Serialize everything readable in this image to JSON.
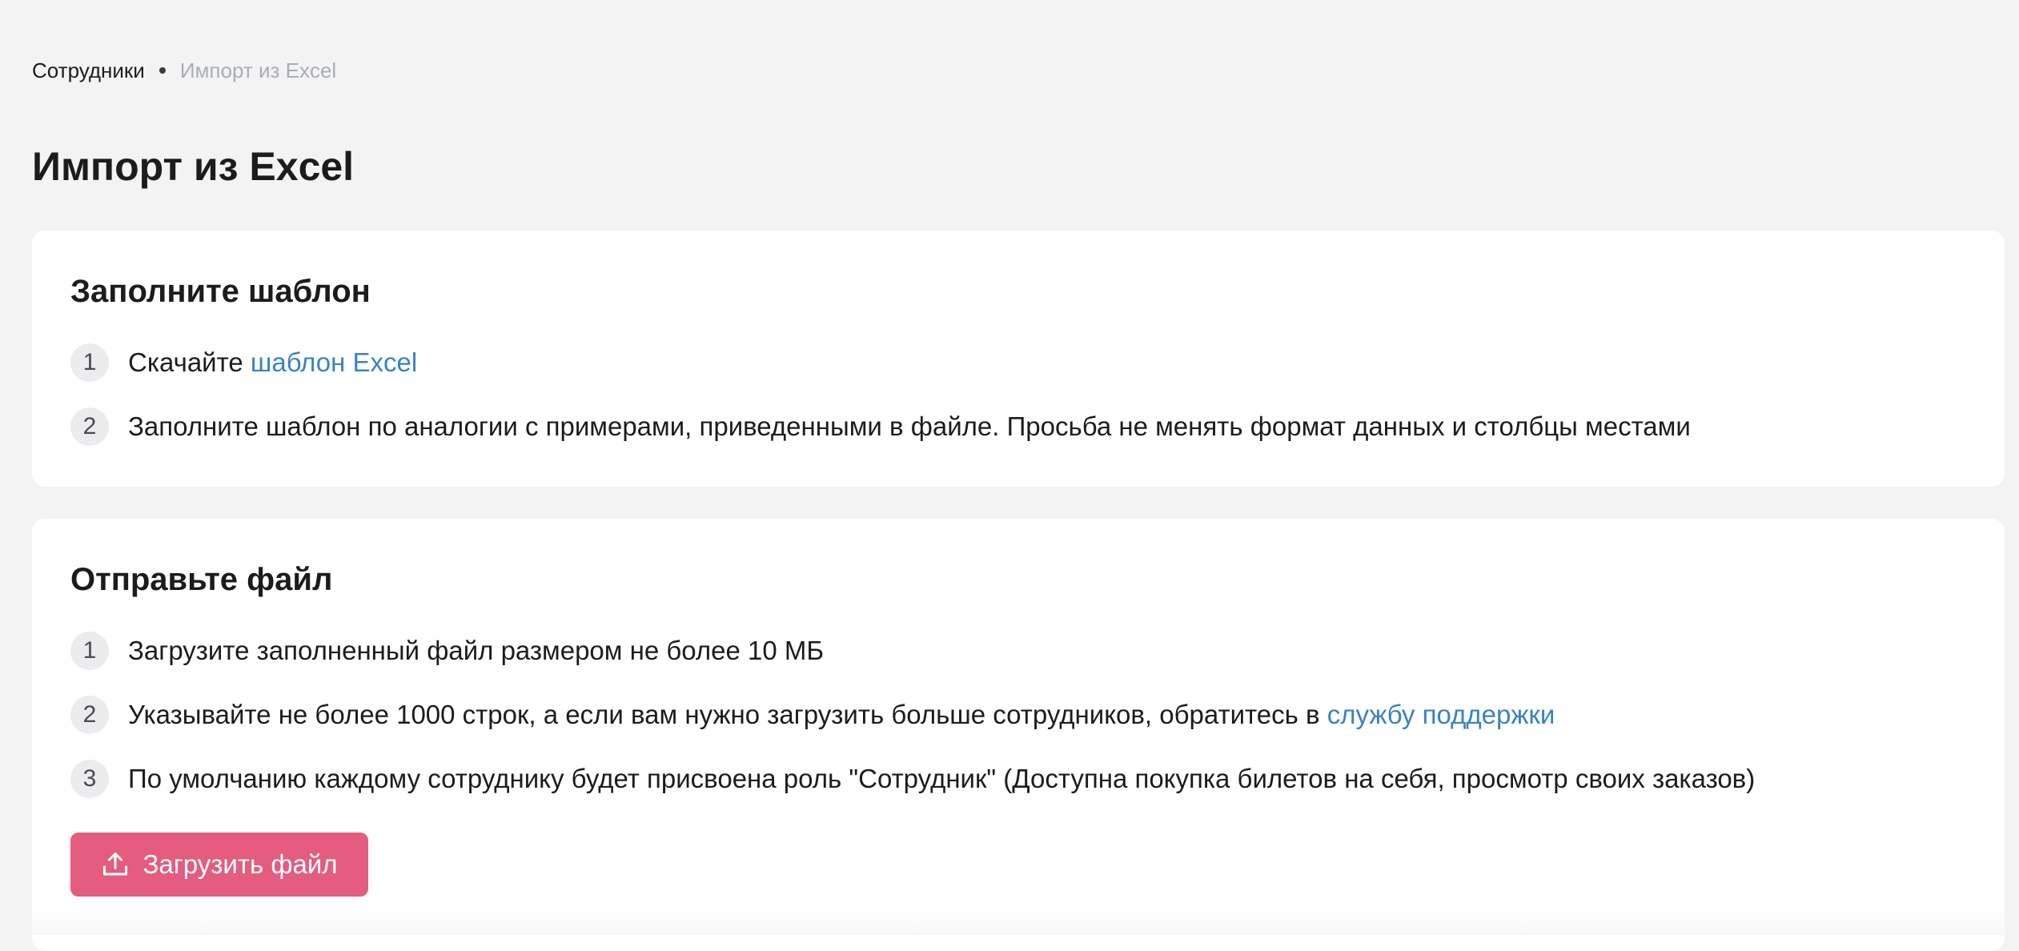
{
  "breadcrumb": {
    "parent": "Сотрудники",
    "current": "Импорт из Excel"
  },
  "page": {
    "title": "Импорт из Excel"
  },
  "template_card": {
    "title": "Заполните шаблон",
    "steps": [
      {
        "num": "1",
        "text": "Скачайте ",
        "link": "шаблон Excel"
      },
      {
        "num": "2",
        "text": "Заполните шаблон по аналогии с примерами, приведенными в файле. Просьба не менять формат данных и столбцы местами"
      }
    ]
  },
  "upload_card": {
    "title": "Отправьте файл",
    "steps": [
      {
        "num": "1",
        "text": "Загрузите заполненный файл размером не более 10 МБ"
      },
      {
        "num": "2",
        "text": "Указывайте не более 1000 строк, а если вам нужно загрузить больше сотрудников, обратитесь в ",
        "link": "службу поддержки"
      },
      {
        "num": "3",
        "text": "По умолчанию каждому сотруднику будет присвоена роль \"Сотрудник\" (Доступна покупка билетов на себя, просмотр своих заказов)"
      }
    ],
    "button_label": "Загрузить файл",
    "button_icon": "upload-icon"
  },
  "colors": {
    "background": "#f3f3f3",
    "card": "#ffffff",
    "link": "#3b82c4",
    "accent_button": "#e45c7f",
    "breadcrumb_current": "#a8adb7"
  }
}
